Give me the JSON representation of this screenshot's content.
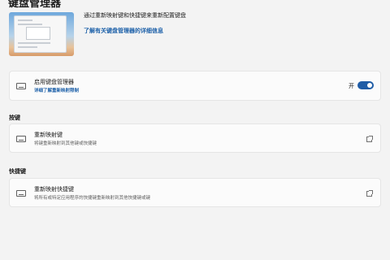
{
  "page": {
    "title": "键盘管理器"
  },
  "hero": {
    "description": "通过重新映射键和快捷键来重新配置键盘",
    "link": "了解有关键盘管理器的详细信息"
  },
  "enable_card": {
    "title": "启用键盘管理器",
    "link": "详细了解重新映射限制",
    "toggle_label": "开",
    "toggle_on": true
  },
  "keys_section": {
    "header": "按键",
    "card_title": "重新映射键",
    "card_sub": "将键重新映射到其他键或快捷键"
  },
  "shortcuts_section": {
    "header": "快捷键",
    "card_title": "重新映射快捷键",
    "card_sub": "将所有或特定应用程序的快捷键重新映射到其他快捷键或键"
  },
  "colors": {
    "accent": "#1f5ca6",
    "link": "#1b5fa8",
    "background": "#f3f3f3",
    "card": "#fbfbfb"
  },
  "icons": [
    "keyboard-icon",
    "external-link-icon"
  ]
}
